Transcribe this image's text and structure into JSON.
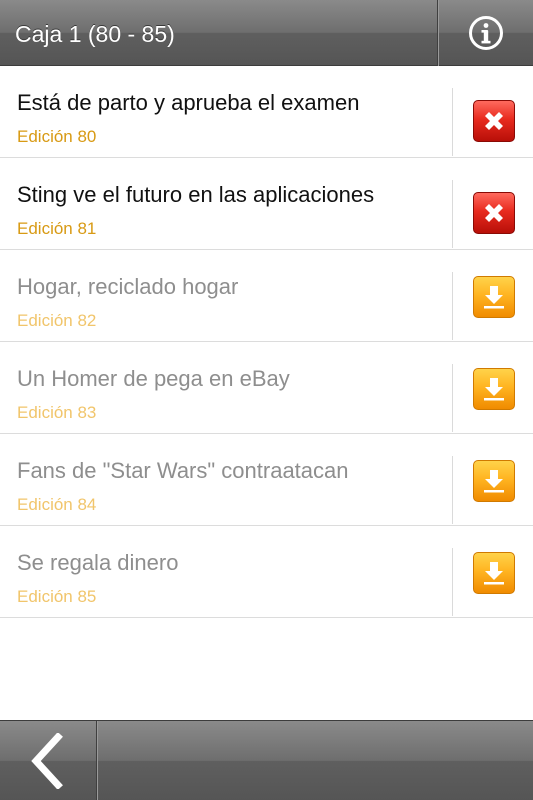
{
  "header": {
    "title": "Caja 1 (80 - 85)",
    "info_icon": "info-icon"
  },
  "items": [
    {
      "title": "Está de parto y aprueba el examen",
      "edition": "Edición 80",
      "status": "downloaded",
      "action_icon": "delete-icon"
    },
    {
      "title": "Sting ve el futuro en las aplicaciones",
      "edition": "Edición 81",
      "status": "downloaded",
      "action_icon": "delete-icon"
    },
    {
      "title": "Hogar, reciclado hogar",
      "edition": "Edición 82",
      "status": "pending",
      "action_icon": "download-icon"
    },
    {
      "title": "Un Homer de pega en eBay",
      "edition": "Edición 83",
      "status": "pending",
      "action_icon": "download-icon"
    },
    {
      "title": "Fans de \"Star Wars\" contraatacan",
      "edition": "Edición 84",
      "status": "pending",
      "action_icon": "download-icon"
    },
    {
      "title": "Se regala dinero",
      "edition": "Edición 85",
      "status": "pending",
      "action_icon": "download-icon"
    }
  ],
  "footer": {
    "back_icon": "back-arrow-icon"
  },
  "colors": {
    "bar": "#6e6e6e",
    "edition_active": "#d89a14",
    "edition_pending": "#f1c56b",
    "delete_red": "#e82b1f",
    "download_orange": "#ffb421"
  }
}
